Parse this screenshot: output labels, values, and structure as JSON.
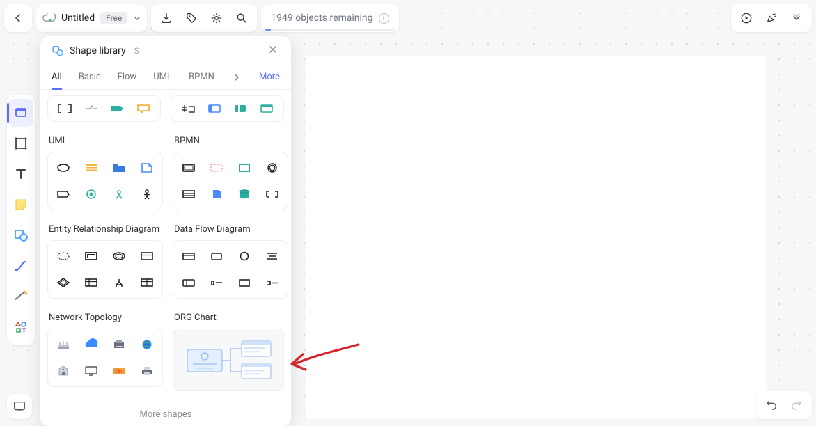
{
  "header": {
    "title": "Untitled",
    "plan_badge": "Free",
    "status_text": "1949 objects remaining",
    "status_fill_percent": 4
  },
  "panel": {
    "title": "Shape library",
    "shortcut": "S",
    "more_label": "More",
    "more_shapes_label": "More shapes",
    "tabs": [
      "All",
      "Basic",
      "Flow",
      "UML",
      "BPMN"
    ],
    "active_tab": "All",
    "categories": {
      "uml": "UML",
      "bpmn": "BPMN",
      "erd": "Entity Relationship Diagram",
      "dfd": "Data Flow Diagram",
      "net": "Network Topology",
      "org": "ORG Chart"
    }
  }
}
